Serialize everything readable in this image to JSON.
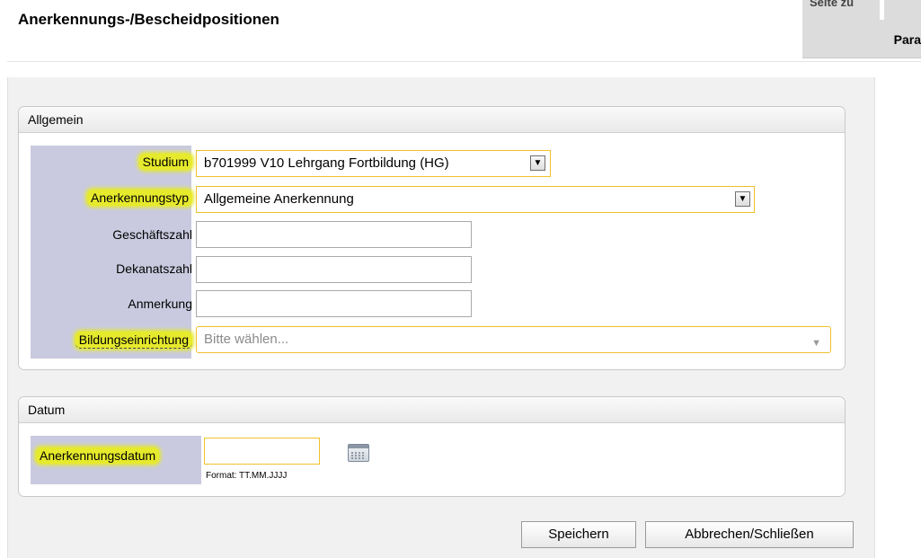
{
  "page": {
    "title": "Anerkennungs-/Bescheidpositionen"
  },
  "top_right": {
    "cut_text": "Seite zu",
    "param_label": "Para"
  },
  "allgemein": {
    "legend": "Allgemein",
    "studium": {
      "label": "Studium",
      "value": "b701999 V10 Lehrgang Fortbildung (HG)"
    },
    "anerkennungstyp": {
      "label": "Anerkennungstyp",
      "value": "Allgemeine Anerkennung"
    },
    "geschaeftszahl": {
      "label": "Geschäftszahl",
      "value": ""
    },
    "dekanatszahl": {
      "label": "Dekanatszahl",
      "value": ""
    },
    "anmerkung": {
      "label": "Anmerkung",
      "value": ""
    },
    "bildungseinrichtung": {
      "label": "Bildungseinrichtung",
      "placeholder": "Bitte wählen..."
    }
  },
  "datum": {
    "legend": "Datum",
    "anerkennungsdatum": {
      "label": "Anerkennungsdatum",
      "value": "",
      "format": "Format: TT.MM.JJJJ"
    }
  },
  "actions": {
    "save_label": "Speichern",
    "cancel_label": "Abbrechen/Schließen"
  },
  "icons": {
    "dropdown": "triangle-down-icon",
    "calendar": "calendar-icon"
  },
  "colors": {
    "highlight": "#e6ea2c",
    "label_column": "#c9cadf",
    "required_border": "#f0c02c"
  }
}
